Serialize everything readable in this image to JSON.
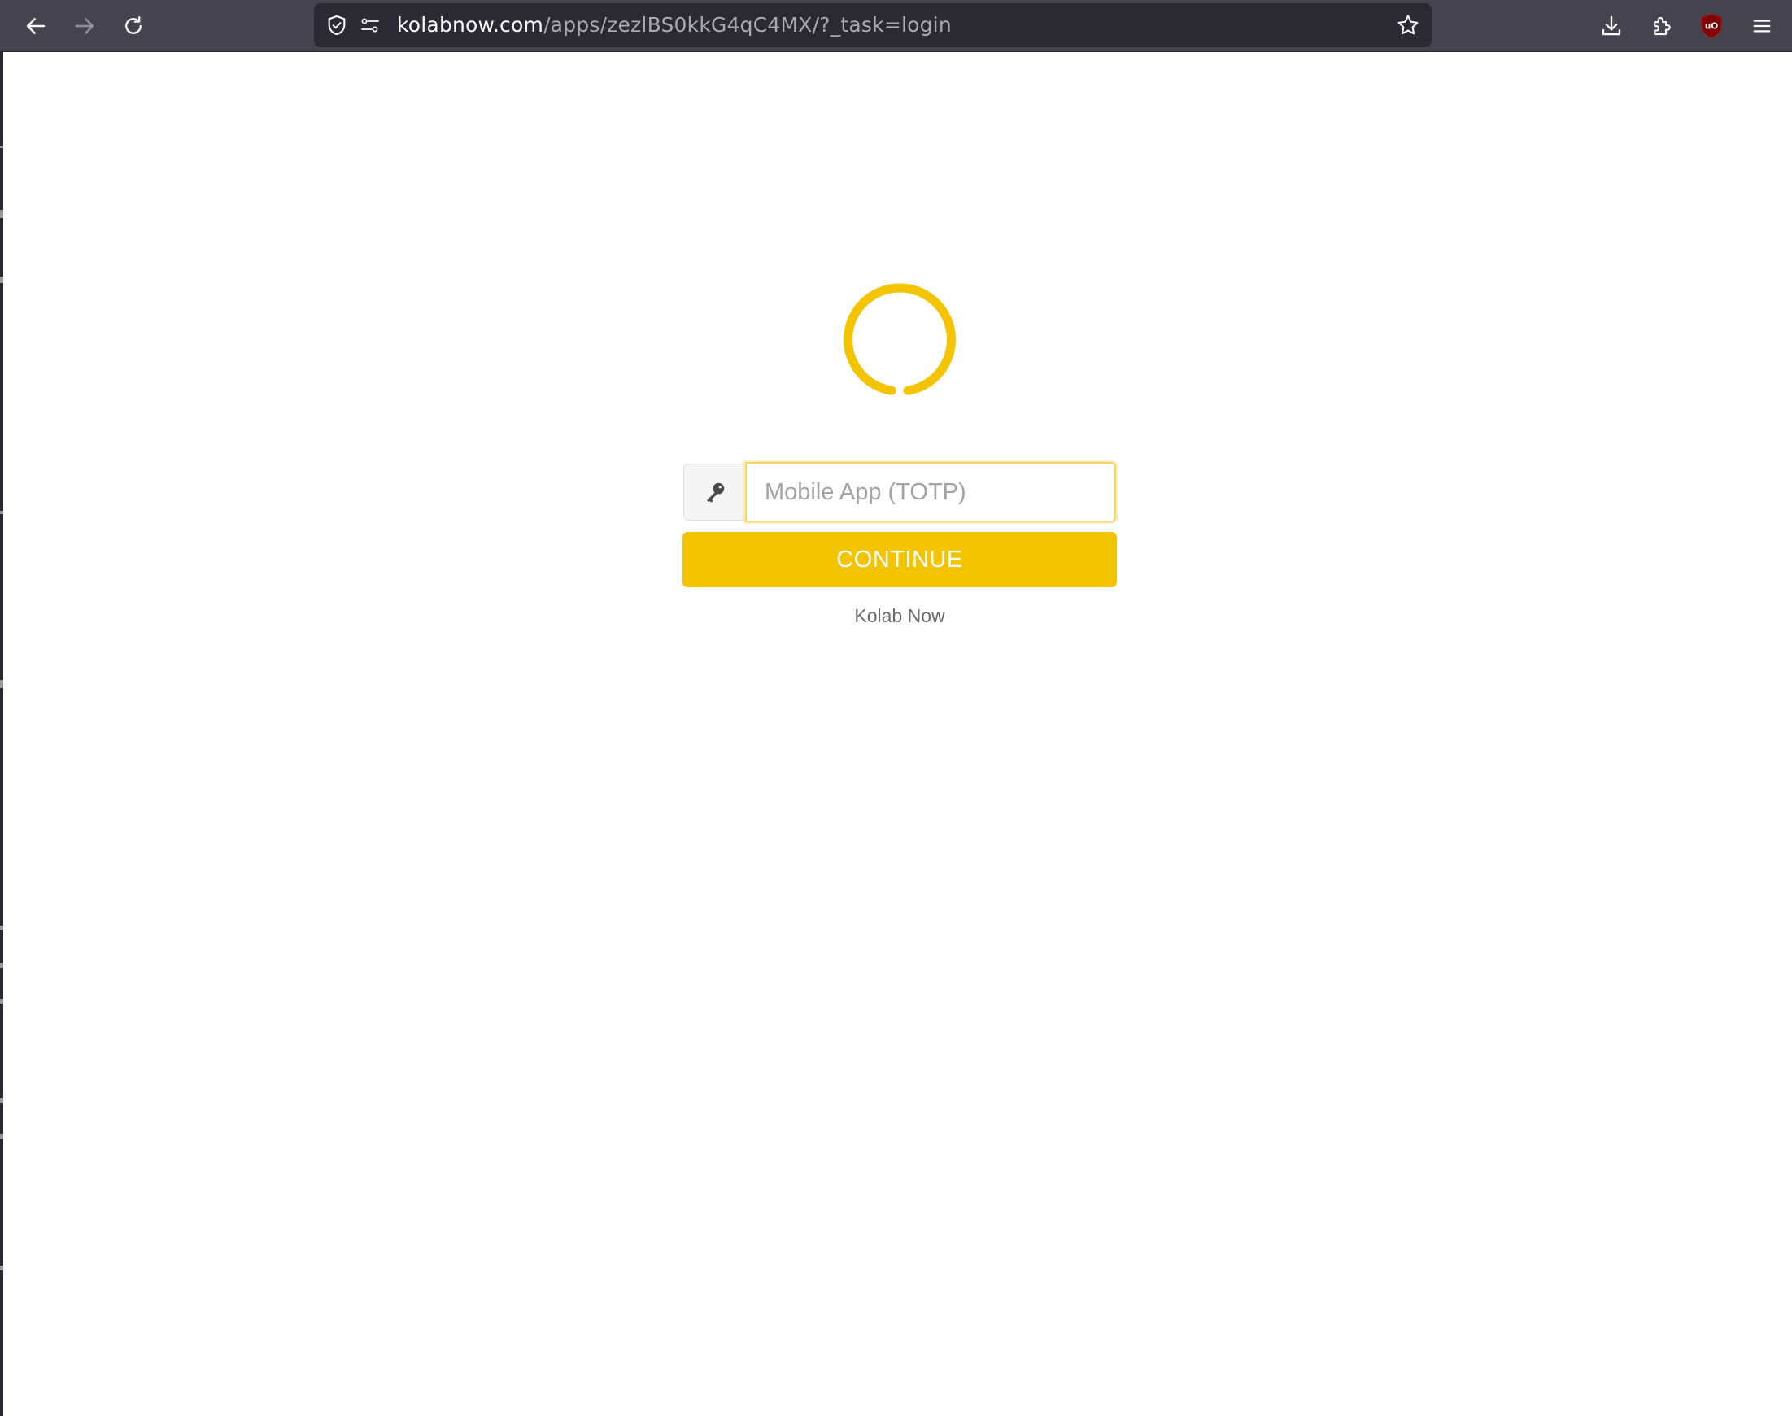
{
  "browser": {
    "url_domain": "kolabnow.com",
    "url_path": "/apps/zezlBS0kkG4qC4MX/?_task=login",
    "icons": {
      "back": "arrow-left-icon",
      "forward": "arrow-right-icon",
      "reload": "reload-icon",
      "tracking_protection": "shield-check-icon",
      "permissions": "permissions-sliders-icon",
      "bookmark": "star-icon",
      "downloads": "download-icon",
      "extensions": "puzzle-icon",
      "ublock": "ublock-origin-icon",
      "menu": "hamburger-menu-icon"
    },
    "ublock_badge_text": "uO"
  },
  "login": {
    "logo_icon": "kolab-ring-logo",
    "accent_color": "#f5c400",
    "field_icon": "key-icon",
    "otp_placeholder": "Mobile App (TOTP)",
    "otp_value": "",
    "continue_label": "CONTINUE",
    "footer_link": "Kolab Now"
  }
}
